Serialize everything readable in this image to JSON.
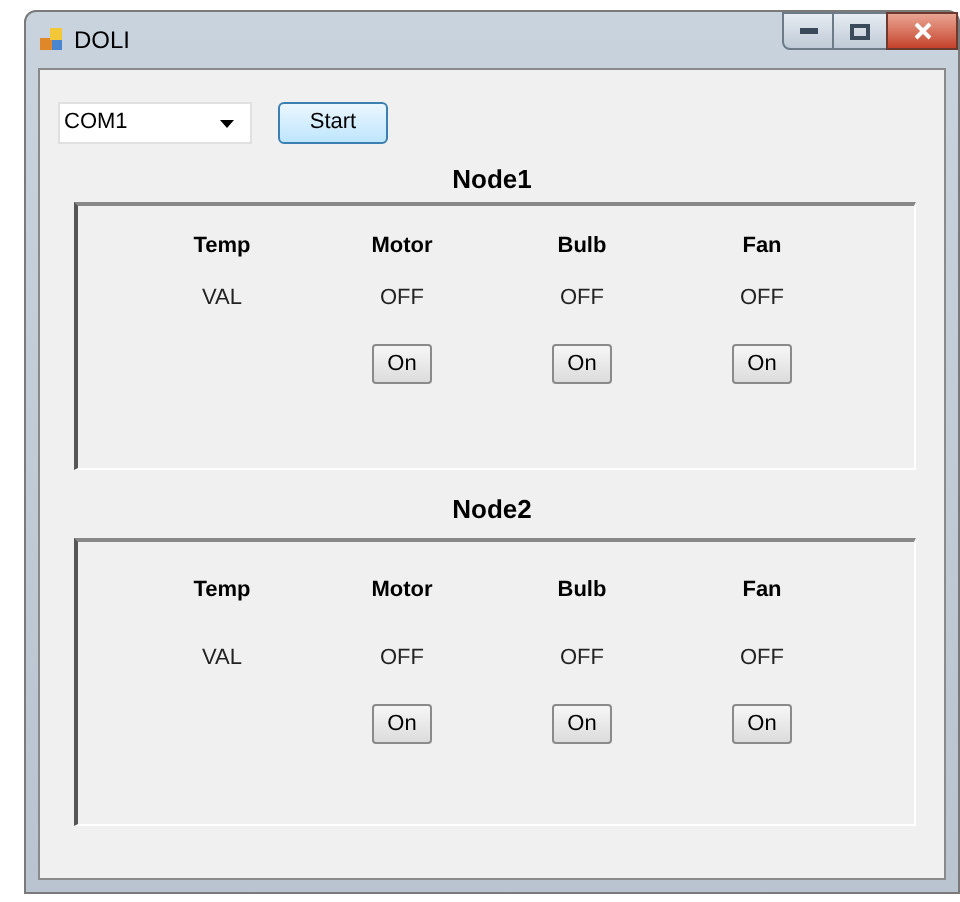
{
  "window": {
    "title": "DOLI"
  },
  "port": {
    "value": "COM1"
  },
  "start_button": "Start",
  "nodes": [
    {
      "title": "Node1",
      "devices": [
        {
          "kind": "sensor",
          "label": "Temp",
          "value": "VAL"
        },
        {
          "kind": "switch",
          "label": "Motor",
          "value": "OFF",
          "button": "On"
        },
        {
          "kind": "switch",
          "label": "Bulb",
          "value": "OFF",
          "button": "On"
        },
        {
          "kind": "switch",
          "label": "Fan",
          "value": "OFF",
          "button": "On"
        }
      ]
    },
    {
      "title": "Node2",
      "devices": [
        {
          "kind": "sensor",
          "label": "Temp",
          "value": "VAL"
        },
        {
          "kind": "switch",
          "label": "Motor",
          "value": "OFF",
          "button": "On"
        },
        {
          "kind": "switch",
          "label": "Bulb",
          "value": "OFF",
          "button": "On"
        },
        {
          "kind": "switch",
          "label": "Fan",
          "value": "OFF",
          "button": "On"
        }
      ]
    }
  ]
}
